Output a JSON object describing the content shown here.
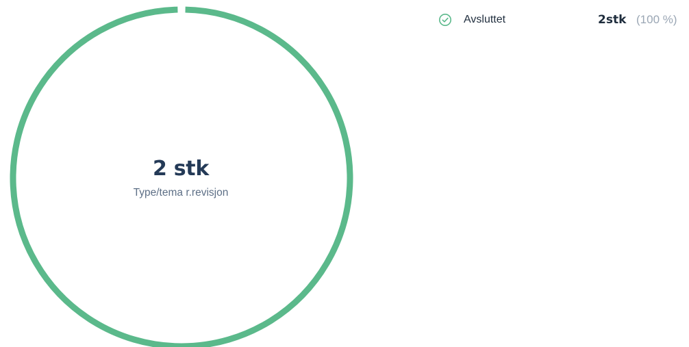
{
  "center": {
    "value": "2 stk",
    "caption": "Type/tema r.revisjon"
  },
  "legend": {
    "items": [
      {
        "label": "Avsluttet",
        "count": "2stk",
        "percent": "(100 %)",
        "icon": "check-circle-icon"
      }
    ]
  },
  "colors": {
    "avsluttet": "#5bb98b"
  },
  "chart_data": {
    "type": "pie",
    "categories": [
      "Avsluttet"
    ],
    "values": [
      2
    ],
    "total": 2,
    "unit": "stk"
  }
}
